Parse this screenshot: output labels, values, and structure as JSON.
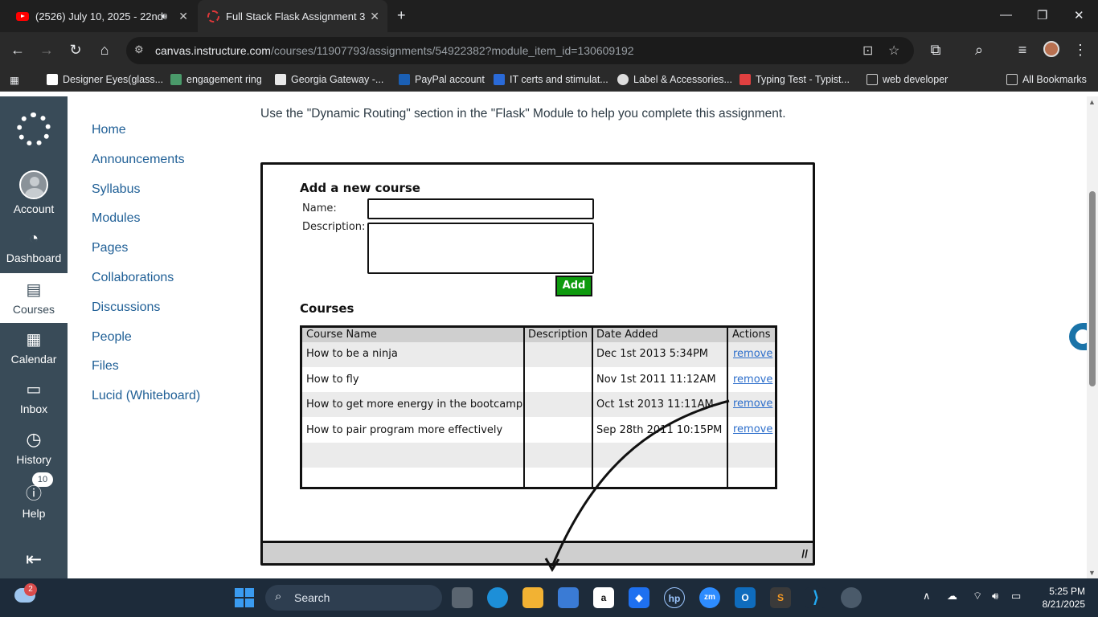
{
  "browser": {
    "tabs": [
      {
        "title": "(2526) July 10, 2025 - 22nd",
        "icon": "youtube-icon",
        "audio": true
      },
      {
        "title": "Full Stack Flask Assignment 3",
        "icon": "loading-icon",
        "active": true
      }
    ],
    "new_tab": "+",
    "url_host": "canvas.instructure.com",
    "url_path": "/courses/11907793/assignments/54922382?module_item_id=130609192",
    "bookmarks": [
      "Designer Eyes(glass...",
      "engagement ring",
      "Georgia Gateway -...",
      "PayPal account",
      "IT certs and stimulat...",
      "Label & Accessories...",
      "Typing Test - Typist...",
      "web developer"
    ],
    "all_bookmarks": "All Bookmarks"
  },
  "global_nav": {
    "items": [
      {
        "label": "Account"
      },
      {
        "label": "Dashboard"
      },
      {
        "label": "Courses",
        "active": true
      },
      {
        "label": "Calendar"
      },
      {
        "label": "Inbox"
      },
      {
        "label": "History"
      },
      {
        "label": "Help",
        "badge": "10"
      }
    ]
  },
  "course_nav": [
    "Home",
    "Announcements",
    "Syllabus",
    "Modules",
    "Pages",
    "Collaborations",
    "Discussions",
    "People",
    "Files",
    "Lucid (Whiteboard)"
  ],
  "content": {
    "intro": "Use the \"Dynamic Routing\" section in the \"Flask\" Module to help you complete this assignment.",
    "mockup": {
      "form_title": "Add a new course",
      "name_label": "Name:",
      "description_label": "Description:",
      "add_button": "Add",
      "courses_title": "Courses",
      "columns": [
        "Course Name",
        "Description",
        "Date Added",
        "Actions"
      ],
      "rows": [
        {
          "name": "How to be a ninja",
          "description": "",
          "date": "Dec 1st 2013 5:34PM",
          "action": "remove"
        },
        {
          "name": "How to fly",
          "description": "",
          "date": "Nov 1st 2011 11:12AM",
          "action": "remove"
        },
        {
          "name": "How to get more energy in the bootcamp",
          "description": "",
          "date": "Oct 1st 2013 11:11AM",
          "action": "remove"
        },
        {
          "name": "How to pair program more effectively",
          "description": "",
          "date": "Sep 28th 2011 10:15PM",
          "action": "remove"
        }
      ]
    }
  },
  "taskbar": {
    "search_label": "Search",
    "weather_badge": "2",
    "time": "5:25 PM",
    "date": "8/21/2025"
  }
}
